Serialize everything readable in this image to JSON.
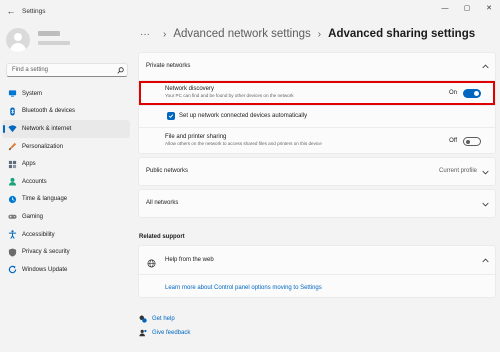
{
  "window": {
    "title": "Settings",
    "back_glyph": "←",
    "minimize_glyph": "—",
    "maximize_glyph": "▢",
    "close_glyph": "✕"
  },
  "sidebar": {
    "search_placeholder": "Find a setting",
    "items": [
      {
        "label": "System",
        "icon": "monitor-icon",
        "color": "#0078d4"
      },
      {
        "label": "Bluetooth & devices",
        "icon": "bluetooth-icon",
        "color": "#0067c0"
      },
      {
        "label": "Network & internet",
        "icon": "wifi-icon",
        "color": "#0067c0",
        "active": true
      },
      {
        "label": "Personalization",
        "icon": "brush-icon",
        "color": "#e3752b"
      },
      {
        "label": "Apps",
        "icon": "apps-icon",
        "color": "#5d6b7a"
      },
      {
        "label": "Accounts",
        "icon": "person-icon",
        "color": "#1aa37a"
      },
      {
        "label": "Time & language",
        "icon": "globe-clock-icon",
        "color": "#0078d4"
      },
      {
        "label": "Gaming",
        "icon": "gamepad-icon",
        "color": "#7a7a7a"
      },
      {
        "label": "Accessibility",
        "icon": "accessibility-icon",
        "color": "#0067c0"
      },
      {
        "label": "Privacy & security",
        "icon": "shield-icon",
        "color": "#6b6b6b"
      },
      {
        "label": "Windows Update",
        "icon": "update-icon",
        "color": "#0067c0"
      }
    ]
  },
  "header": {
    "ellipsis": "···",
    "separator": "›",
    "parent": "Advanced network settings",
    "current": "Advanced sharing settings"
  },
  "private_networks": {
    "title": "Private networks",
    "network_discovery": {
      "label": "Network discovery",
      "description": "Your PC can find and be found by other devices on the network",
      "state_label": "On",
      "on": true
    },
    "auto_setup": {
      "label": "Set up network connected devices automatically",
      "checked": true
    },
    "file_sharing": {
      "label": "File and printer sharing",
      "description": "Allow others on the network to access shared files and printers on this device",
      "state_label": "Off",
      "on": false
    }
  },
  "public_networks": {
    "title": "Public networks",
    "status": "Current profile"
  },
  "all_networks": {
    "title": "All networks"
  },
  "related_support": {
    "heading": "Related support",
    "help_title": "Help from the web",
    "link": "Learn more about Control panel options moving to Settings"
  },
  "footer": {
    "get_help": "Get help",
    "give_feedback": "Give feedback"
  },
  "colors": {
    "accent": "#0067c0",
    "highlight": "#e00000"
  }
}
